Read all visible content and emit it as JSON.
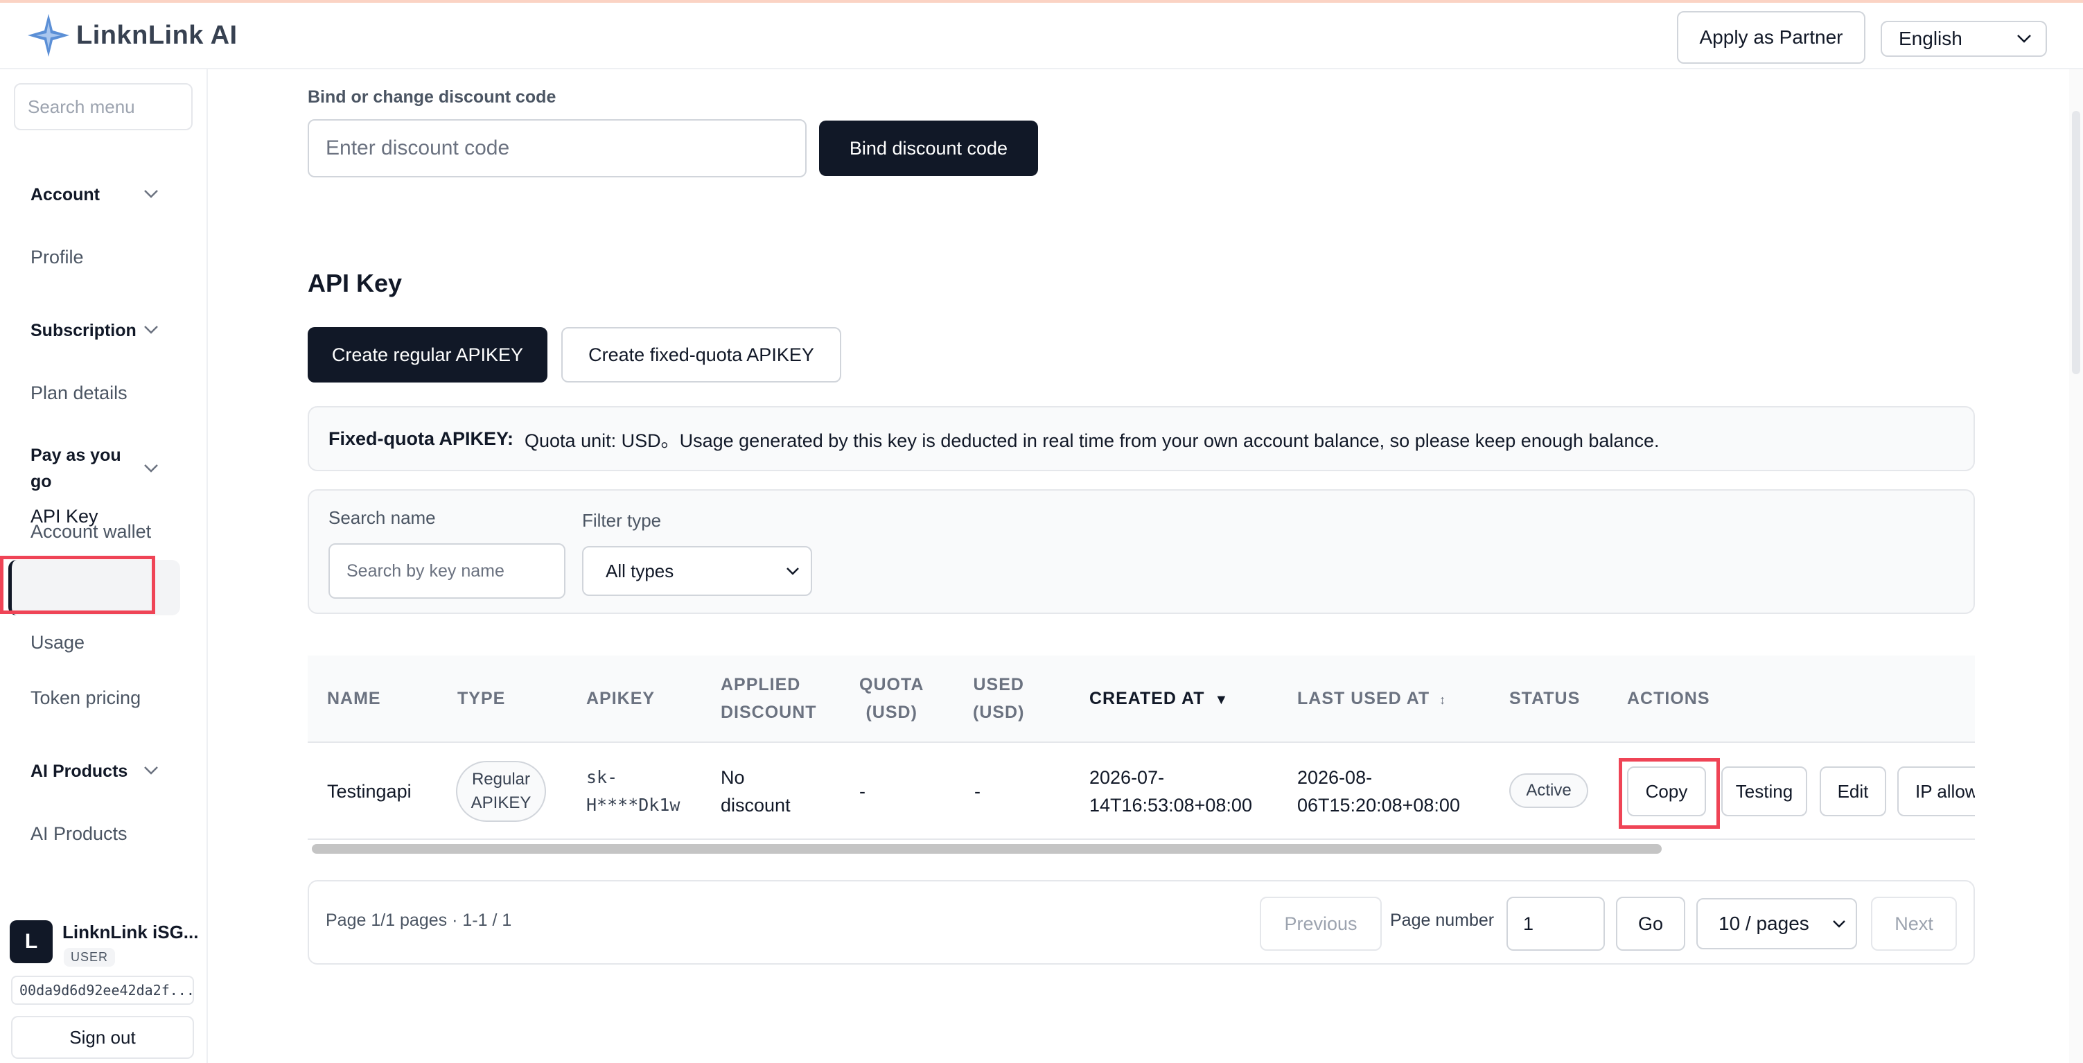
{
  "header": {
    "brand": "LinknLink AI",
    "apply_partner": "Apply as Partner",
    "language": "English"
  },
  "sidebar": {
    "search_placeholder": "Search menu",
    "groups": [
      {
        "label": "Account",
        "items": [
          "Profile"
        ]
      },
      {
        "label": "Subscription",
        "items": [
          "Plan details"
        ]
      },
      {
        "label": "Pay as you go",
        "items": [
          "Account wallet",
          "API Key",
          "Usage",
          "Token pricing"
        ]
      },
      {
        "label": "AI Products",
        "items": [
          "AI Products"
        ]
      }
    ],
    "active_item": "API Key",
    "user": {
      "initial": "L",
      "name": "LinknLink iSG...",
      "role": "USER",
      "id": "00da9d6d92ee42da2f...",
      "sign_out": "Sign out"
    }
  },
  "discount": {
    "label": "Bind or change discount code",
    "placeholder": "Enter discount code",
    "button": "Bind discount code"
  },
  "api_key": {
    "title": "API Key",
    "create_regular": "Create regular APIKEY",
    "create_fixed": "Create fixed-quota APIKEY",
    "notice_title": "Fixed-quota APIKEY:",
    "notice_text": "Quota unit: USD。Usage generated by this key is deducted in real time from your own account balance, so please keep enough balance."
  },
  "filters": {
    "search_label": "Search name",
    "search_placeholder": "Search by key name",
    "type_label": "Filter type",
    "type_value": "All types"
  },
  "table": {
    "columns": {
      "name": "NAME",
      "type": "TYPE",
      "apikey": "APIKEY",
      "applied_discount_1": "APPLIED",
      "applied_discount_2": "DISCOUNT",
      "quota_1": "QUOTA",
      "quota_2": "(USD)",
      "used_1": "USED",
      "used_2": "(USD)",
      "created_at": "CREATED AT",
      "created_sort": "▼",
      "last_used_at": "LAST USED AT",
      "last_used_sort": "↕",
      "status": "STATUS",
      "actions": "ACTIONS"
    },
    "rows": [
      {
        "name": "Testingapi",
        "type_1": "Regular",
        "type_2": "APIKEY",
        "apikey_1": "sk-",
        "apikey_2": "H****Dk1w",
        "discount_1": "No",
        "discount_2": "discount",
        "quota": "-",
        "used": "-",
        "created_1": "2026-07-",
        "created_2": "14T16:53:08+08:00",
        "last_used_1": "2026-08-",
        "last_used_2": "06T15:20:08+08:00",
        "status": "Active",
        "actions": {
          "copy": "Copy",
          "testing": "Testing",
          "edit": "Edit",
          "ip": "IP allow"
        }
      }
    ]
  },
  "pagination": {
    "info": "Page 1/1 pages · 1-1 / 1",
    "previous": "Previous",
    "page_number_label": "Page number",
    "page_number": "1",
    "go": "Go",
    "page_size": "10 / pages",
    "next": "Next"
  },
  "colors": {
    "primary_dark": "#111827",
    "highlight": "#ef4456",
    "top_accent": "#fbd3c4"
  }
}
